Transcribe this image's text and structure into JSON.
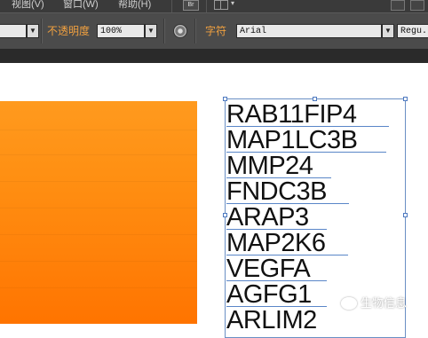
{
  "menubar": {
    "items": [
      "视图(V)",
      "窗口(W)",
      "帮助(H)"
    ],
    "bridge_icon_label": "Br"
  },
  "controlbar": {
    "opacity_label": "不透明度",
    "opacity_value": "100%",
    "character_label": "字符",
    "font_family": "Arial",
    "font_style": "Regu..."
  },
  "canvas": {
    "genes": [
      "RAB11FIP4",
      "MAP1LC3B",
      "MMP24",
      "FNDC3B",
      "ARAP3",
      "MAP2K6",
      "VEGFA",
      "AGFG1",
      "ARLIM2"
    ],
    "colors": {
      "orange_top": "#ff9a1e",
      "orange_bottom": "#ff7400",
      "selection": "#4d79c0"
    }
  },
  "watermark": {
    "text": "生物信息"
  }
}
